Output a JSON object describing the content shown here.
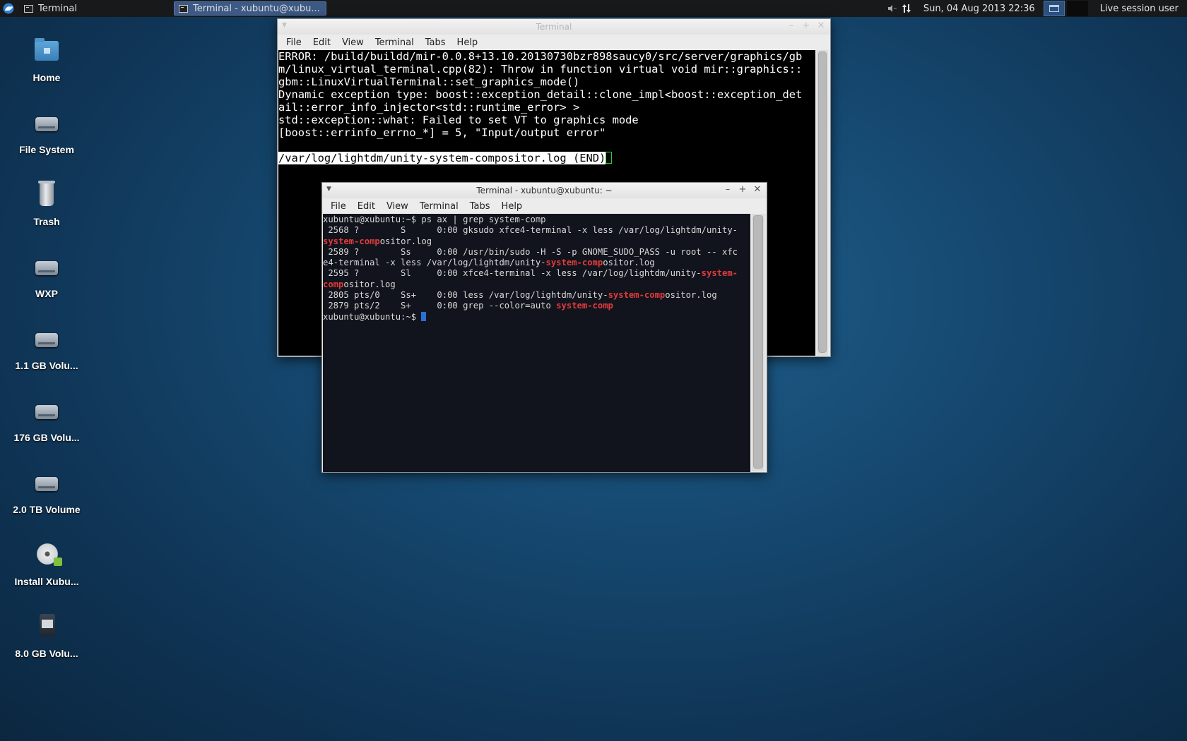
{
  "panel": {
    "taskbar": [
      {
        "label": "Terminal",
        "active": false
      },
      {
        "label": "Terminal - xubuntu@xubu...",
        "active": true
      }
    ],
    "clock": "Sun, 04 Aug 2013 22:36",
    "session_label": "Live session user"
  },
  "desktop_icons": [
    {
      "label": "Home",
      "icon": "home-folder-icon"
    },
    {
      "label": "File System",
      "icon": "drive-icon"
    },
    {
      "label": "Trash",
      "icon": "trash-icon"
    },
    {
      "label": "WXP",
      "icon": "drive-icon"
    },
    {
      "label": "1.1 GB Volu...",
      "icon": "drive-icon"
    },
    {
      "label": "176 GB Volu...",
      "icon": "drive-icon"
    },
    {
      "label": "2.0 TB Volume",
      "icon": "drive-icon"
    },
    {
      "label": "Install Xubu...",
      "icon": "installer-disc-icon"
    },
    {
      "label": "8.0 GB Volu...",
      "icon": "usb-drive-icon"
    }
  ],
  "back_window": {
    "title": "Terminal",
    "menus": [
      "File",
      "Edit",
      "View",
      "Terminal",
      "Tabs",
      "Help"
    ],
    "lines": [
      "ERROR: /build/buildd/mir-0.0.8+13.10.20130730bzr898saucy0/src/server/graphics/gb",
      "m/linux_virtual_terminal.cpp(82): Throw in function virtual void mir::graphics::",
      "gbm::LinuxVirtualTerminal::set_graphics_mode()",
      "Dynamic exception type: boost::exception_detail::clone_impl<boost::exception_det",
      "ail::error_info_injector<std::runtime_error> >",
      "std::exception::what: Failed to set VT to graphics mode",
      "[boost::errinfo_errno_*] = 5, \"Input/output error\"",
      ""
    ],
    "end_line": "/var/log/lightdm/unity-system-compositor.log (END)"
  },
  "front_window": {
    "title": "Terminal - xubuntu@xubuntu: ~",
    "menus": [
      "File",
      "Edit",
      "View",
      "Terminal",
      "Tabs",
      "Help"
    ],
    "lines": [
      [
        {
          "t": "xubuntu@xubuntu:~$ ps ax | grep system-comp"
        }
      ],
      [
        {
          "t": " 2568 ?        S      0:00 gksudo xfce4-terminal -x less /var/log/lightdm/unity-"
        }
      ],
      [
        {
          "t": "system-comp",
          "hl": true
        },
        {
          "t": "ositor.log"
        }
      ],
      [
        {
          "t": " 2589 ?        Ss     0:00 /usr/bin/sudo -H -S -p GNOME_SUDO_PASS -u root -- xfc"
        }
      ],
      [
        {
          "t": "e4-terminal -x less /var/log/lightdm/unity-"
        },
        {
          "t": "system-comp",
          "hl": true
        },
        {
          "t": "ositor.log"
        }
      ],
      [
        {
          "t": " 2595 ?        Sl     0:00 xfce4-terminal -x less /var/log/lightdm/unity-"
        },
        {
          "t": "system-",
          "hl": true
        }
      ],
      [
        {
          "t": "comp",
          "hl": true
        },
        {
          "t": "ositor.log"
        }
      ],
      [
        {
          "t": " 2805 pts/0    Ss+    0:00 less /var/log/lightdm/unity-"
        },
        {
          "t": "system-comp",
          "hl": true
        },
        {
          "t": "ositor.log"
        }
      ],
      [
        {
          "t": " 2879 pts/2    S+     0:00 grep --color=auto "
        },
        {
          "t": "system-comp",
          "hl": true
        }
      ],
      [
        {
          "t": "xubuntu@xubuntu:~$ "
        }
      ]
    ]
  },
  "colors": {
    "highlight": "#e23b3b",
    "cursor_front": "#2a6fd6",
    "cursor_back": "#2bd02b"
  }
}
